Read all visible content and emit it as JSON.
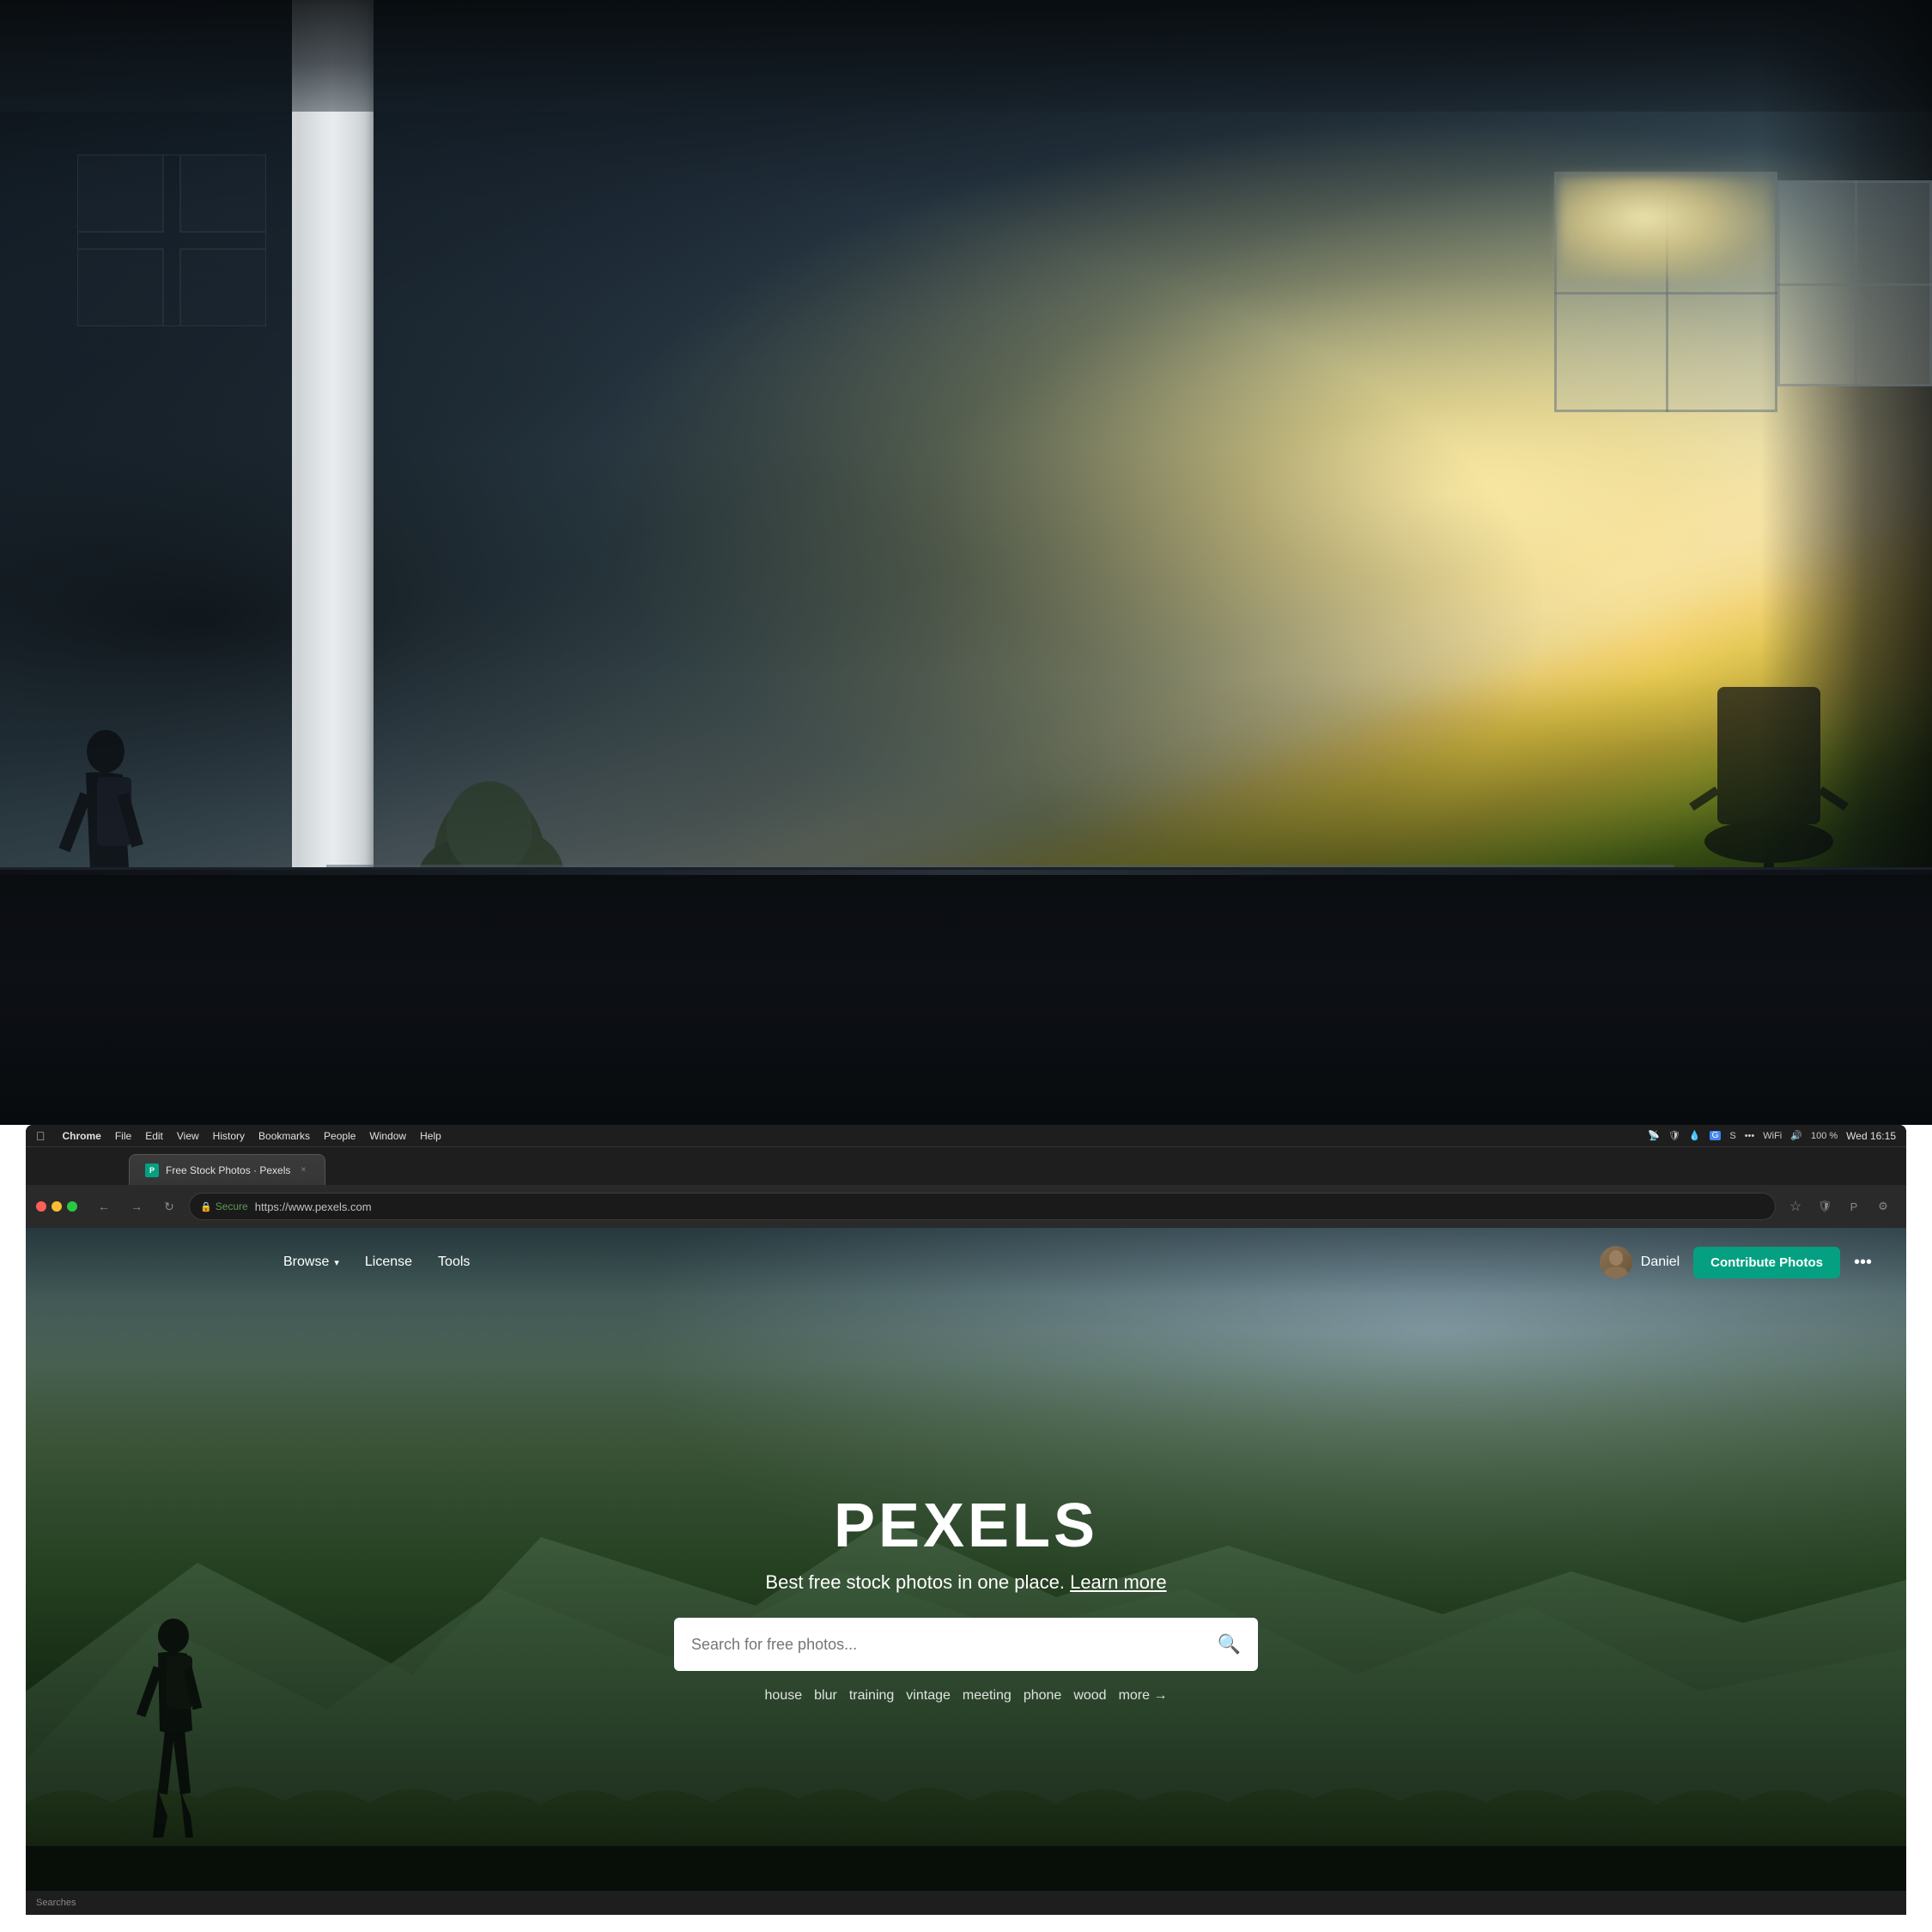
{
  "photo": {
    "alt": "Office interior with sunlight through windows"
  },
  "browser": {
    "tab": {
      "title": "Free Stock Photos · Pexels",
      "favicon_color": "#05a081"
    },
    "address": {
      "secure_label": "Secure",
      "url": "https://www.pexels.com"
    },
    "menu_items": [
      "Chrome",
      "File",
      "Edit",
      "View",
      "History",
      "Bookmarks",
      "People",
      "Window",
      "Help"
    ],
    "clock": "Wed 16:15",
    "battery": "100 %",
    "close_icon": "×"
  },
  "pexels": {
    "logo": "PEXELS",
    "tagline": "Best free stock photos in one place.",
    "learn_more": "Learn more",
    "search_placeholder": "Search for free photos...",
    "search_tags": [
      "house",
      "blur",
      "training",
      "vintage",
      "meeting",
      "phone",
      "wood"
    ],
    "more_label": "more →",
    "nav": {
      "browse_label": "Browse",
      "license_label": "License",
      "tools_label": "Tools",
      "user_name": "Daniel",
      "contribute_label": "Contribute Photos",
      "more_icon": "•••"
    }
  },
  "statusbar": {
    "text": "Searches"
  }
}
